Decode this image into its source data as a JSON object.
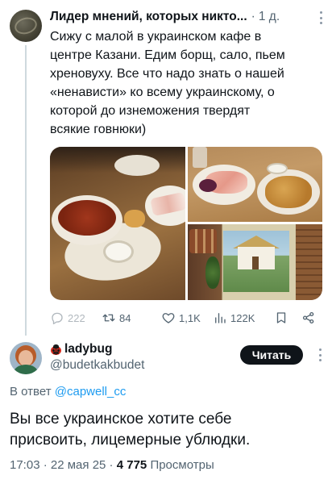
{
  "parent_tweet": {
    "author_name": "Лидер мнений, которых никто...",
    "separator": "·",
    "time": "1 д.",
    "text": "Сижу с малой в украинском кафе в\nцентре Казани. Едим борщ, сало, пьем\nхреновуху. Все что надо знать о нашей\n«ненависти» ко всему украинскому, о\nкоторой до изнеможения твердят\nвсякие говнюки)",
    "actions": {
      "replies": "222",
      "retweets": "84",
      "likes": "1,1K",
      "views": "122K"
    },
    "icons": [
      "reply-icon",
      "retweet-icon",
      "like-icon",
      "views-icon",
      "bookmark-icon",
      "share-icon",
      "more-icon"
    ]
  },
  "reply_tweet": {
    "display_name": "ladybug",
    "handle": "@budetkakbudet",
    "follow_label": "Читать",
    "replying_prefix": "В ответ",
    "replying_to": "@capwell_cc",
    "text": "Вы все украинское хотите себе\nприсвоить, лицемерные ублюдки.",
    "time": "17:03",
    "date": "22 мая 25",
    "dot": "·",
    "views_count": "4 775",
    "views_label": "Просмотры"
  },
  "colors": {
    "text_primary": "#0f1419",
    "text_secondary": "#536471",
    "link": "#1d9bf0",
    "thread_line": "#cfd9de",
    "button_bg": "#0f1419"
  }
}
